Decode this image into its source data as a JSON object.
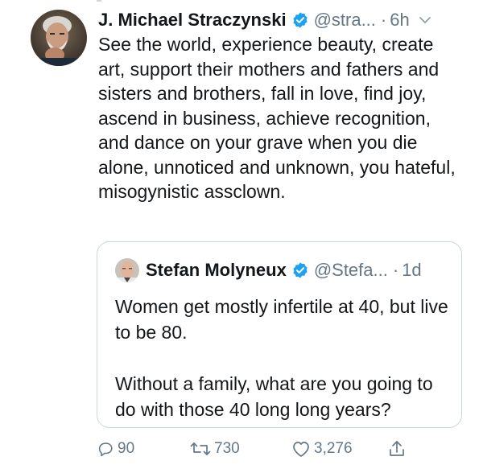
{
  "tweet": {
    "author_name": "J. Michael Straczynski",
    "handle": "@stra...",
    "separator": "·",
    "time": "6h",
    "text": "See the world, experience beauty, create art, support their mothers and fathers and sisters and brothers, fall in love, find joy, ascend in business, achieve recognition, and dance on your grave when you die alone, unnoticed and unknown, you hateful, misogynistic assclown.",
    "avatar_icon": "author-photo",
    "verified_icon": "verified-badge-icon",
    "colors": {
      "verified": "#1da1f2",
      "secondary_text": "#657786",
      "border": "#ccd6dd"
    }
  },
  "quoted_tweet": {
    "author_name": "Stefan Molyneux",
    "handle": "@Stefa...",
    "separator": "·",
    "time": "1d",
    "paragraphs": [
      "Women get mostly infertile at 40, but live to be 80.",
      "Without a family, what are you going to do with those 40 long long years?"
    ]
  },
  "actions": {
    "reply_count": "90",
    "retweet_count": "730",
    "like_count": "3,276"
  }
}
